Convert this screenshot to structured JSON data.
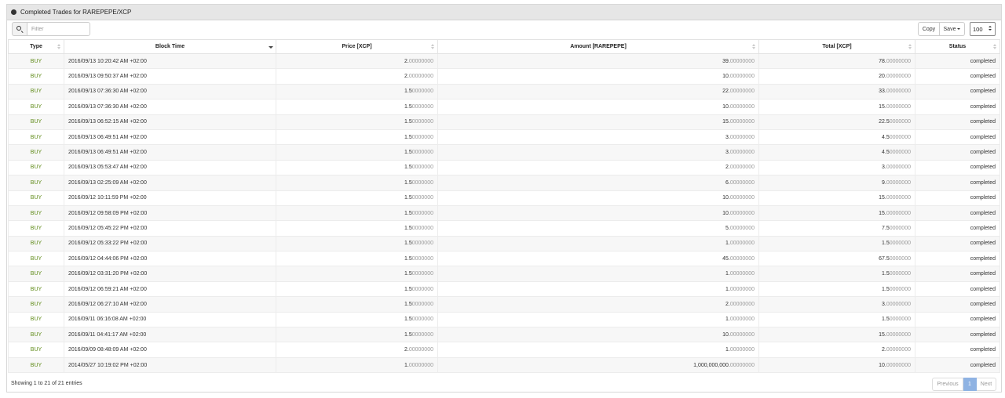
{
  "panel": {
    "title": "Completed Trades for RAREPEPE/XCP"
  },
  "toolbar": {
    "filter_placeholder": "Filter",
    "copy_label": "Copy",
    "save_label": "Save",
    "page_size": "100"
  },
  "table": {
    "columns": [
      "Type",
      "Block Time",
      "Price [XCP]",
      "Amount [RAREPEPE]",
      "Total [XCP]",
      "Status"
    ],
    "rows": [
      {
        "type": "BUY",
        "time": "2016/09/13 10:20:42 AM +02:00",
        "price": [
          "2.",
          "00000000"
        ],
        "amount": [
          "39.",
          "00000000"
        ],
        "total": [
          "78.",
          "00000000"
        ],
        "status": "completed"
      },
      {
        "type": "BUY",
        "time": "2016/09/13 09:50:37 AM +02:00",
        "price": [
          "2.",
          "00000000"
        ],
        "amount": [
          "10.",
          "00000000"
        ],
        "total": [
          "20.",
          "00000000"
        ],
        "status": "completed"
      },
      {
        "type": "BUY",
        "time": "2016/09/13 07:36:30 AM +02:00",
        "price": [
          "1.5",
          "0000000"
        ],
        "amount": [
          "22.",
          "00000000"
        ],
        "total": [
          "33.",
          "00000000"
        ],
        "status": "completed"
      },
      {
        "type": "BUY",
        "time": "2016/09/13 07:36:30 AM +02:00",
        "price": [
          "1.5",
          "0000000"
        ],
        "amount": [
          "10.",
          "00000000"
        ],
        "total": [
          "15.",
          "00000000"
        ],
        "status": "completed"
      },
      {
        "type": "BUY",
        "time": "2016/09/13 06:52:15 AM +02:00",
        "price": [
          "1.5",
          "0000000"
        ],
        "amount": [
          "15.",
          "00000000"
        ],
        "total": [
          "22.5",
          "0000000"
        ],
        "status": "completed"
      },
      {
        "type": "BUY",
        "time": "2016/09/13 06:49:51 AM +02:00",
        "price": [
          "1.5",
          "0000000"
        ],
        "amount": [
          "3.",
          "00000000"
        ],
        "total": [
          "4.5",
          "0000000"
        ],
        "status": "completed"
      },
      {
        "type": "BUY",
        "time": "2016/09/13 06:49:51 AM +02:00",
        "price": [
          "1.5",
          "0000000"
        ],
        "amount": [
          "3.",
          "00000000"
        ],
        "total": [
          "4.5",
          "0000000"
        ],
        "status": "completed"
      },
      {
        "type": "BUY",
        "time": "2016/09/13 05:53:47 AM +02:00",
        "price": [
          "1.5",
          "0000000"
        ],
        "amount": [
          "2.",
          "00000000"
        ],
        "total": [
          "3.",
          "00000000"
        ],
        "status": "completed"
      },
      {
        "type": "BUY",
        "time": "2016/09/13 02:25:09 AM +02:00",
        "price": [
          "1.5",
          "0000000"
        ],
        "amount": [
          "6.",
          "00000000"
        ],
        "total": [
          "9.",
          "00000000"
        ],
        "status": "completed"
      },
      {
        "type": "BUY",
        "time": "2016/09/12 10:11:59 PM +02:00",
        "price": [
          "1.5",
          "0000000"
        ],
        "amount": [
          "10.",
          "00000000"
        ],
        "total": [
          "15.",
          "00000000"
        ],
        "status": "completed"
      },
      {
        "type": "BUY",
        "time": "2016/09/12 09:58:09 PM +02:00",
        "price": [
          "1.5",
          "0000000"
        ],
        "amount": [
          "10.",
          "00000000"
        ],
        "total": [
          "15.",
          "00000000"
        ],
        "status": "completed"
      },
      {
        "type": "BUY",
        "time": "2016/09/12 05:45:22 PM +02:00",
        "price": [
          "1.5",
          "0000000"
        ],
        "amount": [
          "5.",
          "00000000"
        ],
        "total": [
          "7.5",
          "0000000"
        ],
        "status": "completed"
      },
      {
        "type": "BUY",
        "time": "2016/09/12 05:33:22 PM +02:00",
        "price": [
          "1.5",
          "0000000"
        ],
        "amount": [
          "1.",
          "00000000"
        ],
        "total": [
          "1.5",
          "0000000"
        ],
        "status": "completed"
      },
      {
        "type": "BUY",
        "time": "2016/09/12 04:44:06 PM +02:00",
        "price": [
          "1.5",
          "0000000"
        ],
        "amount": [
          "45.",
          "00000000"
        ],
        "total": [
          "67.5",
          "0000000"
        ],
        "status": "completed"
      },
      {
        "type": "BUY",
        "time": "2016/09/12 03:31:20 PM +02:00",
        "price": [
          "1.5",
          "0000000"
        ],
        "amount": [
          "1.",
          "00000000"
        ],
        "total": [
          "1.5",
          "0000000"
        ],
        "status": "completed"
      },
      {
        "type": "BUY",
        "time": "2016/09/12 06:59:21 AM +02:00",
        "price": [
          "1.5",
          "0000000"
        ],
        "amount": [
          "1.",
          "00000000"
        ],
        "total": [
          "1.5",
          "0000000"
        ],
        "status": "completed"
      },
      {
        "type": "BUY",
        "time": "2016/09/12 06:27:10 AM +02:00",
        "price": [
          "1.5",
          "0000000"
        ],
        "amount": [
          "2.",
          "00000000"
        ],
        "total": [
          "3.",
          "00000000"
        ],
        "status": "completed"
      },
      {
        "type": "BUY",
        "time": "2016/09/11 06:16:08 AM +02:00",
        "price": [
          "1.5",
          "0000000"
        ],
        "amount": [
          "1.",
          "00000000"
        ],
        "total": [
          "1.5",
          "0000000"
        ],
        "status": "completed"
      },
      {
        "type": "BUY",
        "time": "2016/09/11 04:41:17 AM +02:00",
        "price": [
          "1.5",
          "0000000"
        ],
        "amount": [
          "10.",
          "00000000"
        ],
        "total": [
          "15.",
          "00000000"
        ],
        "status": "completed"
      },
      {
        "type": "BUY",
        "time": "2016/09/09 08:48:09 AM +02:00",
        "price": [
          "2.",
          "00000000"
        ],
        "amount": [
          "1.",
          "00000000"
        ],
        "total": [
          "2.",
          "00000000"
        ],
        "status": "completed"
      },
      {
        "type": "BUY",
        "time": "2014/05/27 10:19:02 PM +02:00",
        "price": [
          "1.",
          "00000000"
        ],
        "amount": [
          "1,000,000,000.",
          "00000000"
        ],
        "total": [
          "10.",
          "00000000"
        ],
        "status": "completed"
      }
    ]
  },
  "footer": {
    "info": "Showing 1 to 21 of 21 entries",
    "prev_label": "Previous",
    "page_label": "1",
    "next_label": "Next"
  },
  "colors": {
    "buy": "#5e8a16",
    "pager_active": "#8fb3e3",
    "header_bg": "#e6e6e6"
  }
}
